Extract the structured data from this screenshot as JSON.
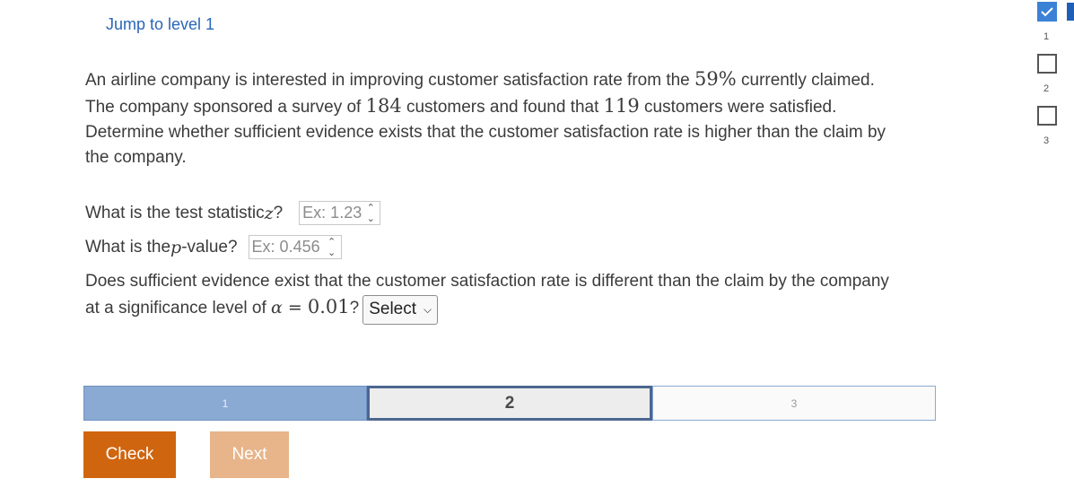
{
  "nav": {
    "jump_label": "Jump to level 1"
  },
  "problem": {
    "l1a": "An airline company is interested in improving customer satisfaction rate from the ",
    "rate": "59%",
    "l1b": " currently claimed.",
    "l2a": "The company sponsored a survey of ",
    "surveyed": "184",
    "l2b": " customers and found that ",
    "satisfied": "119",
    "l2c": " customers were satisfied.",
    "l3": "Determine whether sufficient evidence exists that the customer satisfaction rate is higher than the claim by",
    "l4": "the company."
  },
  "q1": {
    "pre": "What is the test statistic ",
    "var": "z",
    "post": "?",
    "placeholder": "Ex: 1.23"
  },
  "q2": {
    "pre": "What is the ",
    "var": "p",
    "post": "-value?",
    "placeholder": "Ex: 0.456"
  },
  "q3": {
    "line1": "Does sufficient evidence exist that the customer satisfaction rate is different than the claim by the company",
    "line2a": "at a significance level of ",
    "alpha": "α",
    "eq": " = ",
    "alpha_value": "0.01",
    "line2b": "?",
    "select_value": "Select"
  },
  "progress": {
    "steps": [
      "1",
      "2",
      "3"
    ],
    "current": 2
  },
  "buttons": {
    "check": "Check",
    "next": "Next"
  },
  "levels": [
    {
      "label": "1",
      "status": "done"
    },
    {
      "label": "2",
      "status": "todo"
    },
    {
      "label": "3",
      "status": "todo"
    }
  ],
  "colors": {
    "accent": "#d0650f",
    "link": "#2a66b8",
    "progress": "#8aaad3",
    "done": "#3b82d6"
  }
}
